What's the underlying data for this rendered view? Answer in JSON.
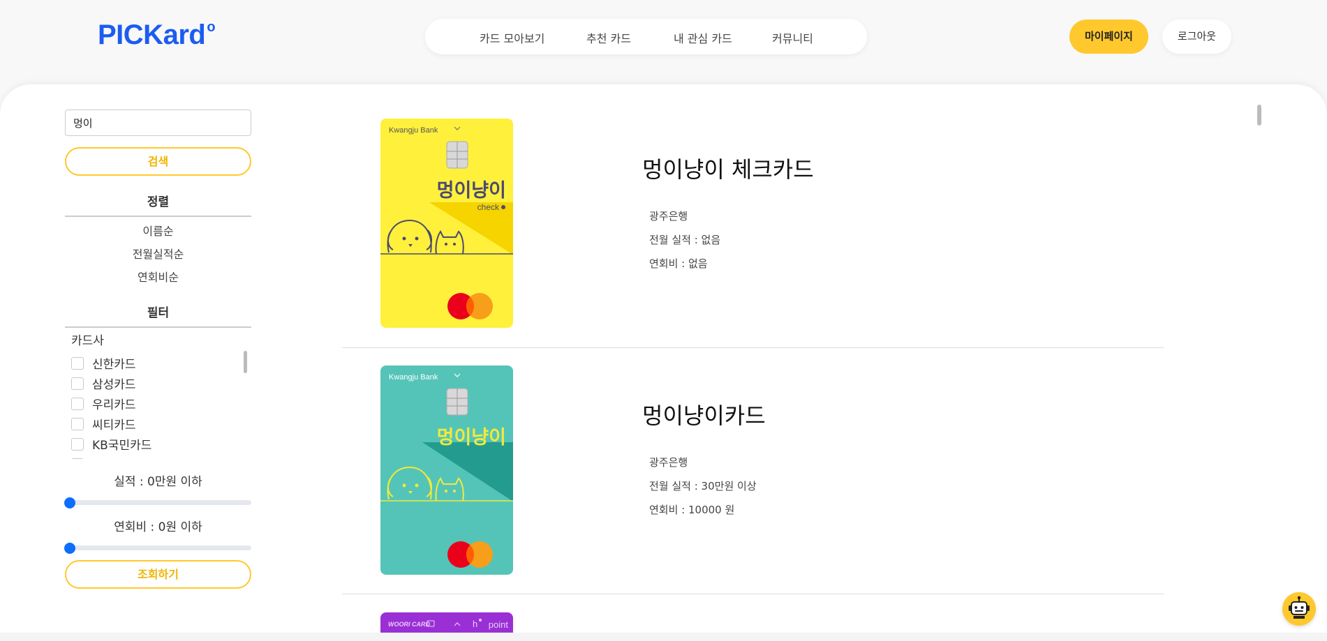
{
  "brand": {
    "logo": "PICKard",
    "logo_mark": "o",
    "accent": "#1c5cf0",
    "highlight": "#ffc82c"
  },
  "nav": {
    "items": [
      {
        "label": "카드 모아보기"
      },
      {
        "label": "추천 카드"
      },
      {
        "label": "내 관심 카드"
      },
      {
        "label": "커뮤니티"
      }
    ],
    "mypage_label": "마이페이지",
    "logout_label": "로그아웃"
  },
  "sidebar": {
    "search_value": "멍이",
    "search_button": "검색",
    "sort_title": "정렬",
    "sort_options": [
      {
        "label": "이름순"
      },
      {
        "label": "전월실적순"
      },
      {
        "label": "연회비순"
      }
    ],
    "filter_title": "필터",
    "issuer_label": "카드사",
    "issuers": [
      {
        "label": "신한카드"
      },
      {
        "label": "삼성카드"
      },
      {
        "label": "우리카드"
      },
      {
        "label": "씨티카드"
      },
      {
        "label": "KB국민카드"
      }
    ],
    "performance_label": "실적 : 0만원 이하",
    "performance_value": 0,
    "fee_label": "연회비 : 0원 이하",
    "fee_value": 0,
    "submit_button": "조회하기"
  },
  "cards": [
    {
      "name": "멍이냥이 체크카드",
      "bank": "광주은행",
      "performance": "전월 실적 : 없음",
      "fee": "연회비 : 없음",
      "image": {
        "bank_text": "Kwangju Bank",
        "title_text": "멍이냥이",
        "sub_text": "check",
        "bg": "#fff03c",
        "stripe": "#f5d400",
        "line_color": "#4a4a70"
      }
    },
    {
      "name": "멍이냥이카드",
      "bank": "광주은행",
      "performance": "전월 실적 : 30만원 이상",
      "fee": "연회비 : 10000 원",
      "image": {
        "bank_text": "Kwangju Bank",
        "title_text": "멍이냥이",
        "bg": "#55c4b8",
        "stripe": "#239b8f",
        "line_color": "#f1ea3a"
      }
    },
    {
      "image": {
        "bank_text": "WOORI CARD",
        "point_text": "point",
        "bg": "#9b2fd6"
      }
    }
  ]
}
